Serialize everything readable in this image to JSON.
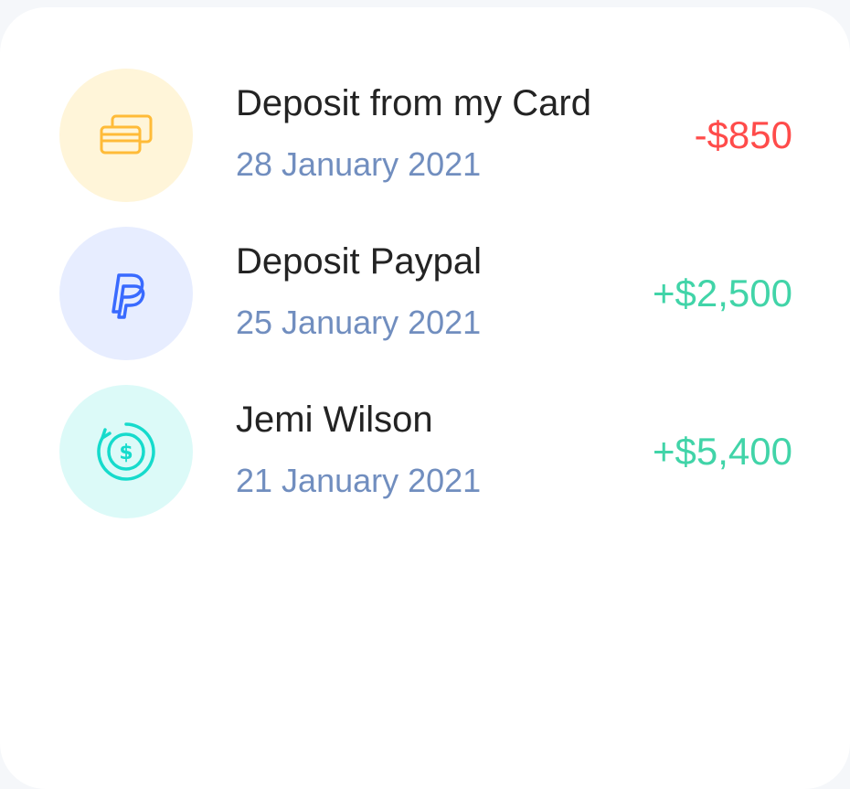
{
  "colors": {
    "negative": "#FF4B4A",
    "positive": "#41D4A8",
    "title": "#232323",
    "date": "#718EBF"
  },
  "transactions": [
    {
      "icon": "card-icon",
      "icon_bg": "#FFF5D9",
      "icon_color": "#FFBB38",
      "title": "Deposit from my Card",
      "date": "28 January 2021",
      "amount": "-$850",
      "amount_type": "negative"
    },
    {
      "icon": "paypal-icon",
      "icon_bg": "#E7EDFF",
      "icon_color": "#396AFF",
      "title": "Deposit Paypal",
      "date": "25 January 2021",
      "amount": "+$2,500",
      "amount_type": "positive"
    },
    {
      "icon": "dollar-coin-icon",
      "icon_bg": "#DCFAF8",
      "icon_color": "#16DBCC",
      "title": "Jemi Wilson",
      "date": "21 January 2021",
      "amount": "+$5,400",
      "amount_type": "positive"
    }
  ]
}
